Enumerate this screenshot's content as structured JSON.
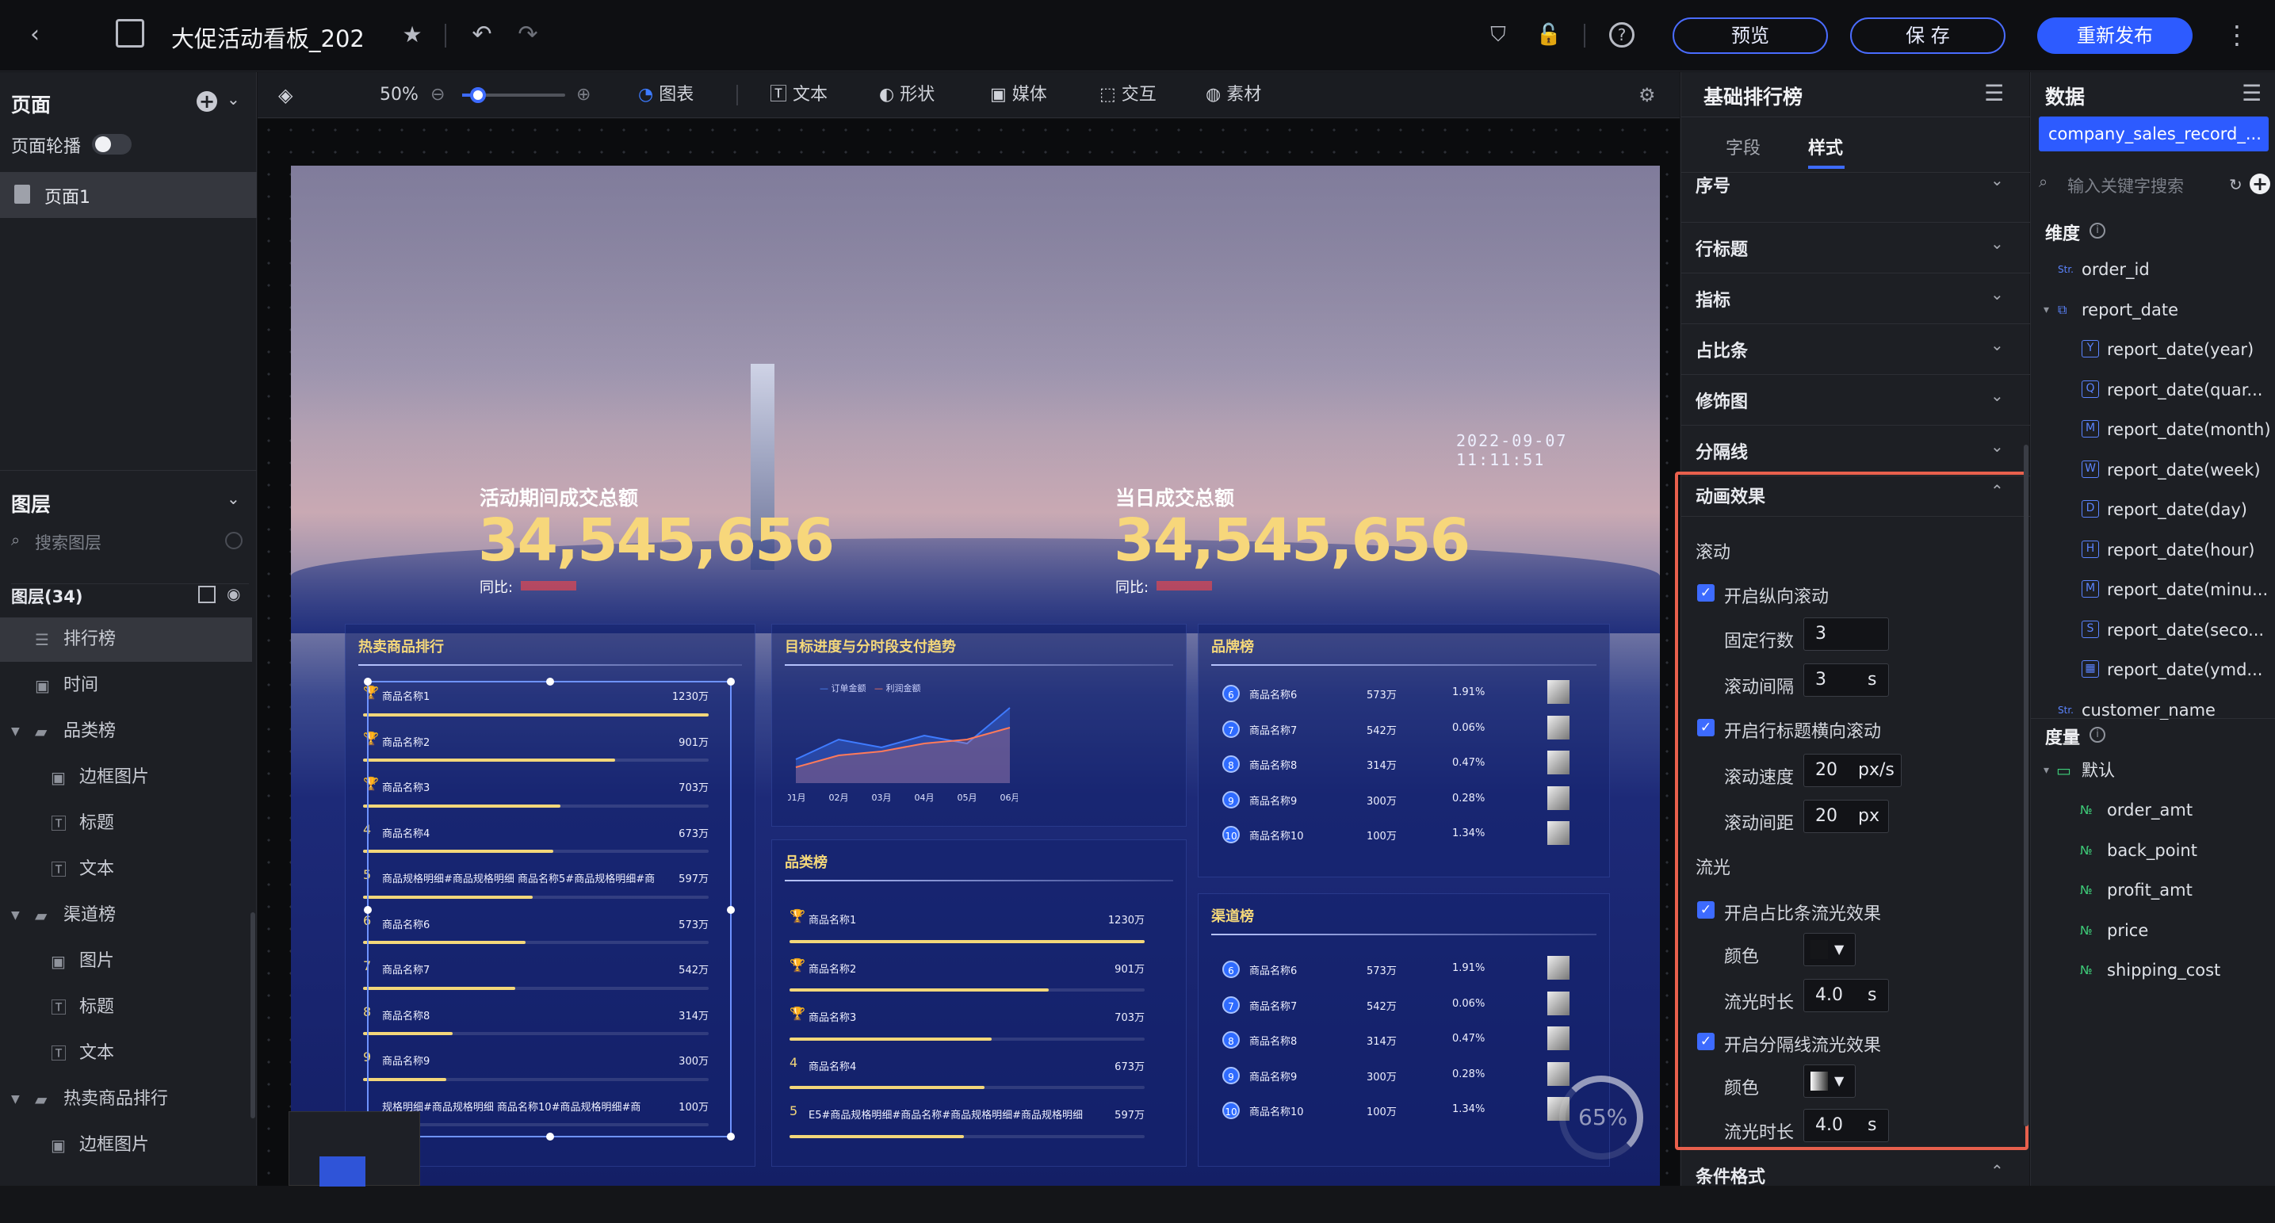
{
  "topbar": {
    "title": "大促活动看板_202",
    "preview": "预览",
    "save": "保 存",
    "republish": "重新发布",
    "icons": [
      "back-icon",
      "dashboard-icon",
      "star-icon",
      "undo-icon",
      "redo-icon",
      "shield-icon",
      "lock-icon",
      "help-icon",
      "more-icon"
    ]
  },
  "left": {
    "pages_title": "页面",
    "carousel": "页面轮播",
    "page1": "页面1",
    "layers_title": "图层",
    "search_placeholder": "搜索图层",
    "layers_count": "图层(34)",
    "layers": [
      {
        "label": "排行榜",
        "icon": "list-icon",
        "indent": 1,
        "selected": true
      },
      {
        "label": "时间",
        "icon": "image-icon",
        "indent": 1
      },
      {
        "label": "品类榜",
        "icon": "folder-icon",
        "indent": 0,
        "expand": true
      },
      {
        "label": "边框图片",
        "icon": "image-icon",
        "indent": 2
      },
      {
        "label": "标题",
        "icon": "text-icon",
        "indent": 2
      },
      {
        "label": "文本",
        "icon": "text-icon",
        "indent": 2
      },
      {
        "label": "渠道榜",
        "icon": "folder-icon",
        "indent": 0,
        "expand": true
      },
      {
        "label": "图片",
        "icon": "image-icon",
        "indent": 2
      },
      {
        "label": "标题",
        "icon": "text-icon",
        "indent": 2
      },
      {
        "label": "文本",
        "icon": "text-icon",
        "indent": 2
      },
      {
        "label": "热卖商品排行",
        "icon": "folder-icon",
        "indent": 0,
        "expand": true
      },
      {
        "label": "边框图片",
        "icon": "image-icon",
        "indent": 2
      }
    ]
  },
  "toolbar": {
    "zoom": "50%",
    "chart": "图表",
    "text": "文本",
    "shape": "形状",
    "media": "媒体",
    "interact": "交互",
    "material": "素材"
  },
  "dash": {
    "datetime": "2022-09-07  11:11:51",
    "kpi1_label": "活动期间成交总额",
    "kpi1_value": "34,545,656",
    "kpi2_label": "当日成交总额",
    "kpi2_value": "34,545,656",
    "yoy": "同比:",
    "hot": {
      "title": "热卖商品排行",
      "rows": [
        {
          "idx": "🏆",
          "name": "商品名称1",
          "value": "1230万",
          "pct": 1.0
        },
        {
          "idx": "🏆",
          "name": "商品名称2",
          "value": "901万",
          "pct": 0.73
        },
        {
          "idx": "🏆",
          "name": "商品名称3",
          "value": "703万",
          "pct": 0.57
        },
        {
          "idx": "4",
          "name": "商品名称4",
          "value": "673万",
          "pct": 0.55
        },
        {
          "idx": "5",
          "name": "商品规格明细#商品规格明细   商品名称5#商品规格明细#商",
          "value": "597万",
          "pct": 0.49
        },
        {
          "idx": "6",
          "name": "商品名称6",
          "value": "573万",
          "pct": 0.47
        },
        {
          "idx": "7",
          "name": "商品名称7",
          "value": "542万",
          "pct": 0.44
        },
        {
          "idx": "8",
          "name": "商品名称8",
          "value": "314万",
          "pct": 0.26
        },
        {
          "idx": "9",
          "name": "商品名称9",
          "value": "300万",
          "pct": 0.24
        },
        {
          "idx": "",
          "name": "规格明细#商品规格明细    商品名称10#商品规格明细#商",
          "value": "100万",
          "pct": 0.08
        }
      ]
    },
    "trend": {
      "title": "目标进度与分时段支付趋势",
      "legend1": "订单金额",
      "legend2": "利润金额"
    },
    "cat": {
      "title": "品类榜",
      "rows": [
        {
          "idx": "🏆",
          "name": "商品名称1",
          "value": "1230万",
          "pct": 1.0
        },
        {
          "idx": "🏆",
          "name": "商品名称2",
          "value": "901万",
          "pct": 0.73
        },
        {
          "idx": "🏆",
          "name": "商品名称3",
          "value": "703万",
          "pct": 0.57
        },
        {
          "idx": "4",
          "name": "商品名称4",
          "value": "673万",
          "pct": 0.55
        },
        {
          "idx": "5",
          "name": "E5#商品规格明细#商品名称#商品规格明细#商品规格明细",
          "value": "597万",
          "pct": 0.49
        }
      ]
    },
    "brand": {
      "title": "品牌榜",
      "rows": [
        {
          "n": "6",
          "name": "商品名称6",
          "v": "573万",
          "p": "1.91%"
        },
        {
          "n": "7",
          "name": "商品名称7",
          "v": "542万",
          "p": "0.06%"
        },
        {
          "n": "8",
          "name": "商品名称8",
          "v": "314万",
          "p": "0.47%"
        },
        {
          "n": "9",
          "name": "商品名称9",
          "v": "300万",
          "p": "0.28%"
        },
        {
          "n": "10",
          "name": "商品名称10",
          "v": "100万",
          "p": "1.34%"
        }
      ]
    },
    "channel": {
      "title": "渠道榜",
      "rows": [
        {
          "n": "6",
          "name": "商品名称6",
          "v": "573万",
          "p": "1.91%"
        },
        {
          "n": "7",
          "name": "商品名称7",
          "v": "542万",
          "p": "0.06%"
        },
        {
          "n": "8",
          "name": "商品名称8",
          "v": "314万",
          "p": "0.47%"
        },
        {
          "n": "9",
          "name": "商品名称9",
          "v": "300万",
          "p": "0.28%"
        },
        {
          "n": "10",
          "name": "商品名称10",
          "v": "100万",
          "p": "1.34%"
        }
      ]
    },
    "gauge": "65%"
  },
  "chart_data": {
    "type": "line",
    "categories": [
      "01月",
      "02月",
      "03月",
      "04月",
      "05月",
      "06月"
    ],
    "series": [
      {
        "name": "订单金额",
        "values": [
          30,
          55,
          45,
          60,
          50,
          95
        ]
      },
      {
        "name": "利润金额",
        "values": [
          20,
          35,
          40,
          50,
          55,
          70
        ]
      }
    ],
    "ylim": [
      0,
      100
    ]
  },
  "style_panel": {
    "title": "基础排行榜",
    "tab_field": "字段",
    "tab_style": "样式",
    "sections": [
      "序号",
      "行标题",
      "指标",
      "占比条",
      "修饰图",
      "分隔线"
    ],
    "anim_title": "动画效果",
    "scroll_group": "滚动",
    "v_scroll": "开启纵向滚动",
    "fixed_rows": "固定行数",
    "fixed_rows_val": "3",
    "scroll_interval": "滚动间隔",
    "scroll_interval_val": "3",
    "unit_s": "s",
    "h_scroll": "开启行标题横向滚动",
    "scroll_speed": "滚动速度",
    "scroll_speed_val": "20",
    "unit_pxs": "px/s",
    "scroll_gap": "滚动间距",
    "scroll_gap_val": "20",
    "unit_px": "px",
    "flow_group": "流光",
    "flow1": "开启占比条流光效果",
    "color": "颜色",
    "flow_duration": "流光时长",
    "flow_duration_val": "4.0",
    "flow2": "开启分隔线流光效果",
    "cond_format": "条件格式"
  },
  "data_panel": {
    "title": "数据",
    "dataset": "company_sales_record_...",
    "search_placeholder": "输入关键字搜索",
    "dims_title": "维度",
    "measures_title": "度量",
    "dims": [
      {
        "type": "Str.",
        "label": "order_id",
        "indent": 0
      },
      {
        "type": "tree",
        "label": "report_date",
        "indent": 0
      },
      {
        "type": "Y",
        "label": "report_date(year)",
        "indent": 1
      },
      {
        "type": "Q",
        "label": "report_date(quar...",
        "indent": 1
      },
      {
        "type": "M",
        "label": "report_date(month)",
        "indent": 1
      },
      {
        "type": "W",
        "label": "report_date(week)",
        "indent": 1
      },
      {
        "type": "D",
        "label": "report_date(day)",
        "indent": 1
      },
      {
        "type": "H",
        "label": "report_date(hour)",
        "indent": 1
      },
      {
        "type": "M",
        "label": "report_date(minu...",
        "indent": 1
      },
      {
        "type": "S",
        "label": "report_date(seco...",
        "indent": 1
      },
      {
        "type": "cal",
        "label": "report_date(ymd...",
        "indent": 1
      },
      {
        "type": "Str.",
        "label": "customer_name",
        "indent": 0
      }
    ],
    "measure_group": "默认",
    "measures": [
      "order_amt",
      "back_point",
      "profit_amt",
      "price",
      "shipping_cost"
    ]
  }
}
